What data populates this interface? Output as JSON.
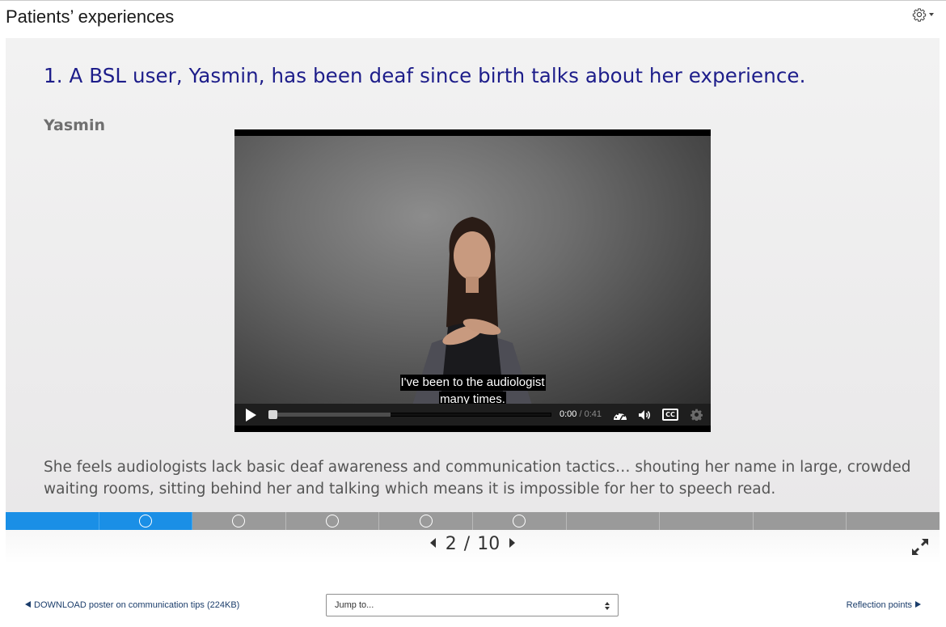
{
  "page": {
    "title": "Patients’ experiences"
  },
  "settings": {
    "icon": "gear-icon"
  },
  "slide": {
    "heading": "1.  A BSL user, Yasmin, has been deaf since birth talks about her experience.",
    "speaker": "Yasmin",
    "description": "She feels audiologists lack basic deaf awareness and communication tactics… shouting her name in large, crowded waiting rooms, sitting behind her and talking which means it is impossible for her to speech read."
  },
  "video": {
    "caption_line1": "I've been to the audiologist",
    "caption_line2": "many times.",
    "current_time": "0:00",
    "separator": " / ",
    "duration": "0:41",
    "played_fraction": 0.0,
    "buffered_fraction": 0.43,
    "icons": [
      "play-icon",
      "playback-speed-icon",
      "volume-icon",
      "closed-captions-icon",
      "settings-gear-icon"
    ]
  },
  "progress": {
    "segments": [
      {
        "done": true,
        "marker": false
      },
      {
        "done": true,
        "marker": true
      },
      {
        "done": false,
        "marker": true
      },
      {
        "done": false,
        "marker": true
      },
      {
        "done": false,
        "marker": true
      },
      {
        "done": false,
        "marker": true
      },
      {
        "done": false,
        "marker": false
      },
      {
        "done": false,
        "marker": false
      },
      {
        "done": false,
        "marker": false
      },
      {
        "done": false,
        "marker": false
      }
    ],
    "accent_color": "#1a8fe6"
  },
  "pager": {
    "current": "2",
    "separator": "/",
    "total": "10"
  },
  "nav": {
    "prev_label": "DOWNLOAD poster on communication tips (224KB)",
    "jump_placeholder": "Jump to...",
    "next_label": "Reflection points"
  }
}
